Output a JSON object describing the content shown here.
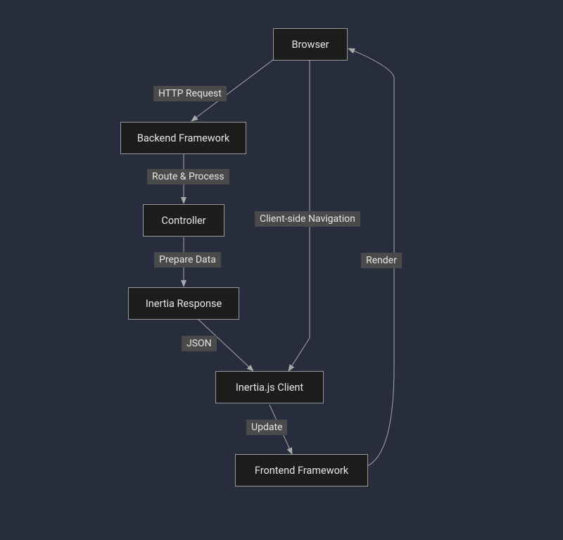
{
  "nodes": {
    "browser": "Browser",
    "backend": "Backend Framework",
    "controller": "Controller",
    "inertia_response": "Inertia Response",
    "inertia_client": "Inertia.js Client",
    "frontend": "Frontend Framework"
  },
  "edges": {
    "http_request": "HTTP Request",
    "route_process": "Route & Process",
    "prepare_data": "Prepare Data",
    "json": "JSON",
    "client_nav": "Client-side Navigation",
    "update": "Update",
    "render": "Render"
  },
  "chart_data": {
    "type": "flowchart",
    "nodes": [
      {
        "id": "browser",
        "label": "Browser"
      },
      {
        "id": "backend",
        "label": "Backend Framework"
      },
      {
        "id": "controller",
        "label": "Controller"
      },
      {
        "id": "inertia_response",
        "label": "Inertia Response"
      },
      {
        "id": "inertia_client",
        "label": "Inertia.js Client"
      },
      {
        "id": "frontend",
        "label": "Frontend Framework"
      }
    ],
    "edges": [
      {
        "from": "browser",
        "to": "backend",
        "label": "HTTP Request"
      },
      {
        "from": "backend",
        "to": "controller",
        "label": "Route & Process"
      },
      {
        "from": "controller",
        "to": "inertia_response",
        "label": "Prepare Data"
      },
      {
        "from": "inertia_response",
        "to": "inertia_client",
        "label": "JSON"
      },
      {
        "from": "browser",
        "to": "inertia_client",
        "label": "Client-side Navigation"
      },
      {
        "from": "inertia_client",
        "to": "frontend",
        "label": "Update"
      },
      {
        "from": "frontend",
        "to": "browser",
        "label": "Render"
      }
    ]
  }
}
